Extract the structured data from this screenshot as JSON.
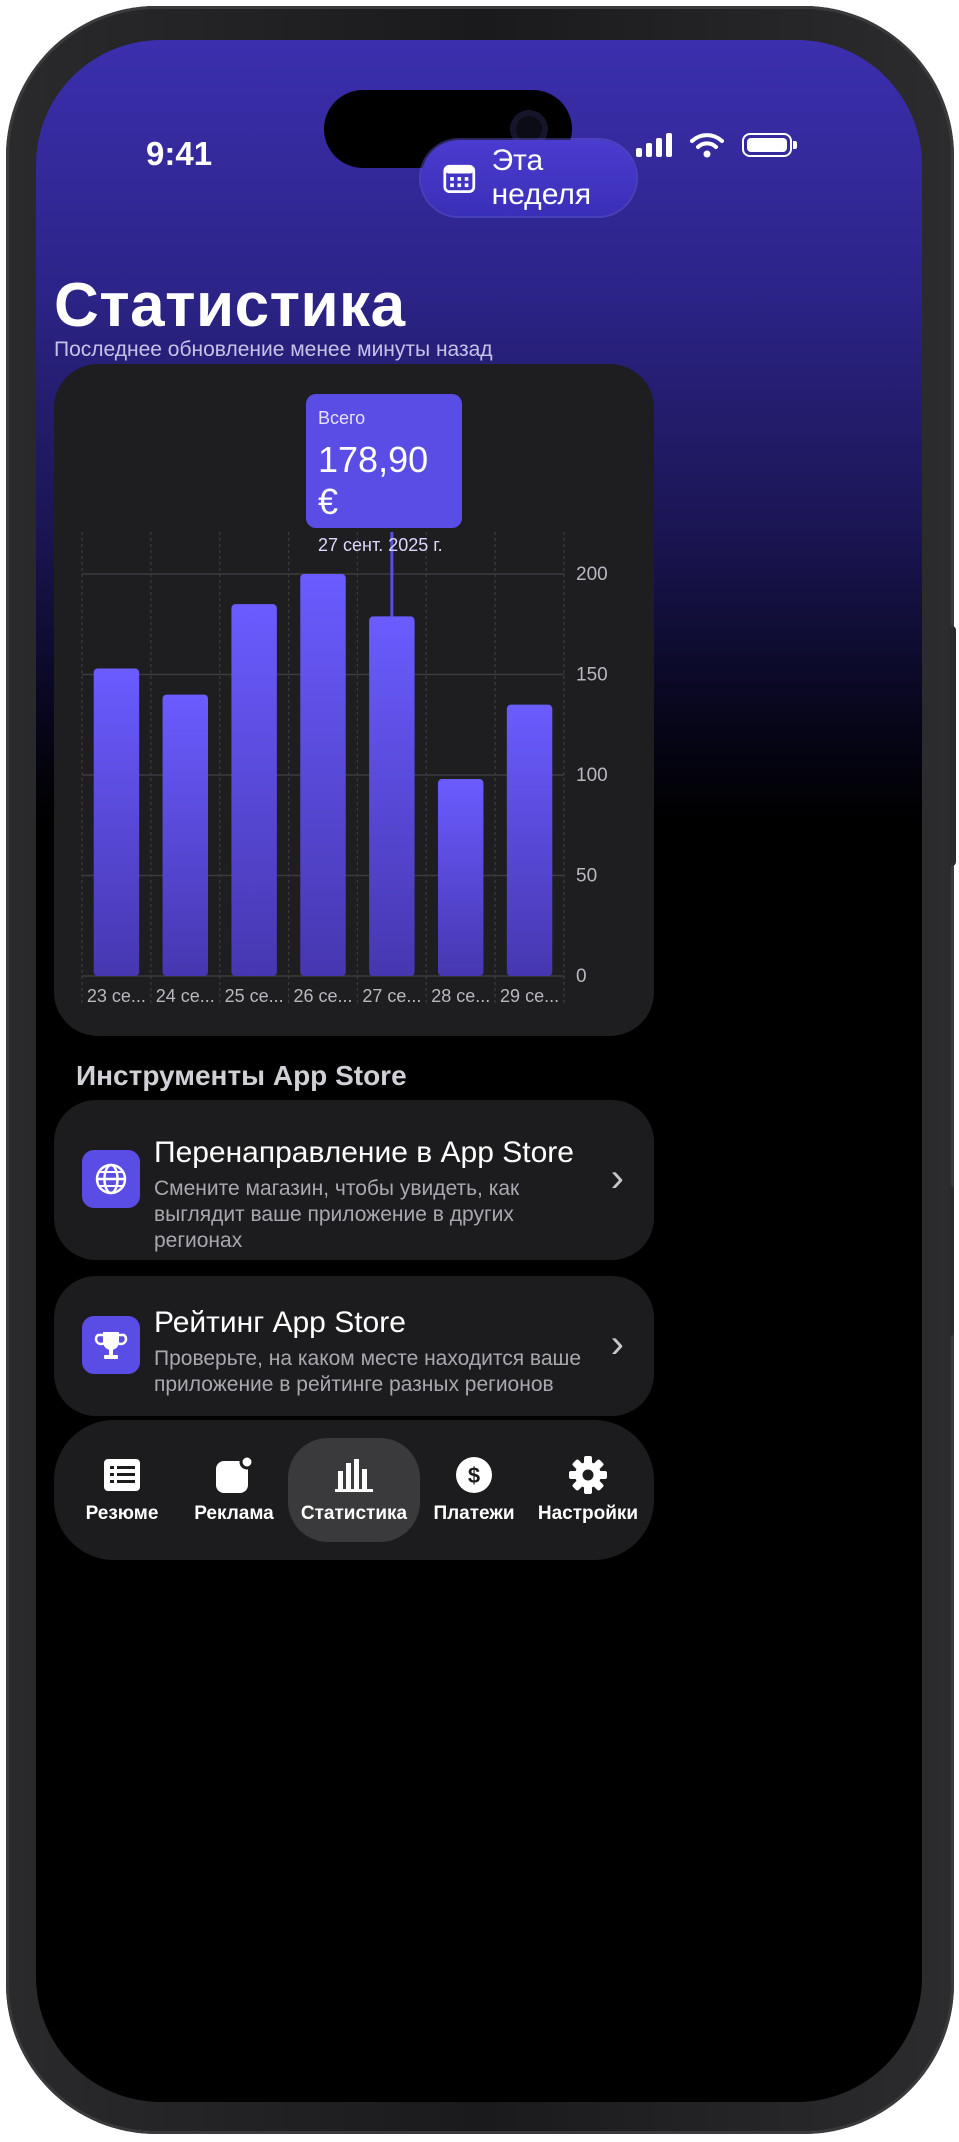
{
  "status_bar": {
    "time": "9:41"
  },
  "header": {
    "period_button": {
      "label": "Эта неделя",
      "icon": "calendar-icon"
    },
    "title": "Статистика",
    "subtitle": "Последнее обновление менее минуты назад"
  },
  "chart_data": {
    "type": "bar",
    "categories": [
      "23 се...",
      "24 се...",
      "25 се...",
      "26 се...",
      "27 се...",
      "28 се...",
      "29 се..."
    ],
    "values": [
      153,
      140,
      185,
      200,
      178.9,
      98,
      135
    ],
    "ylim": [
      0,
      200
    ],
    "yticks": [
      0,
      50,
      100,
      150,
      200
    ],
    "grid": true,
    "bar_color": "#6a5cff",
    "selected_index": 4,
    "tooltip": {
      "label": "Всего",
      "value": "178,90 €",
      "date": "27 сент. 2025 г."
    }
  },
  "tools": {
    "section_title": "Инструменты App Store",
    "items": [
      {
        "title": "Перенаправление в App Store",
        "description": "Смените магазин, чтобы увидеть, как выглядит ваше приложение в других регионах",
        "icon": "globe-icon"
      },
      {
        "title": "Рейтинг App Store",
        "description": "Проверьте, на каком месте находится ваше приложение в рейтинге разных регионов",
        "icon": "trophy-icon"
      }
    ]
  },
  "tabbar": {
    "items": [
      {
        "label": "Резюме",
        "icon": "summary-icon"
      },
      {
        "label": "Реклама",
        "icon": "ads-icon"
      },
      {
        "label": "Статистика",
        "icon": "chart-icon",
        "active": true
      },
      {
        "label": "Платежи",
        "icon": "dollar-icon"
      },
      {
        "label": "Настройки",
        "icon": "gear-icon"
      }
    ]
  },
  "colors": {
    "accent": "#5a4de6",
    "card": "#1e1e21"
  }
}
